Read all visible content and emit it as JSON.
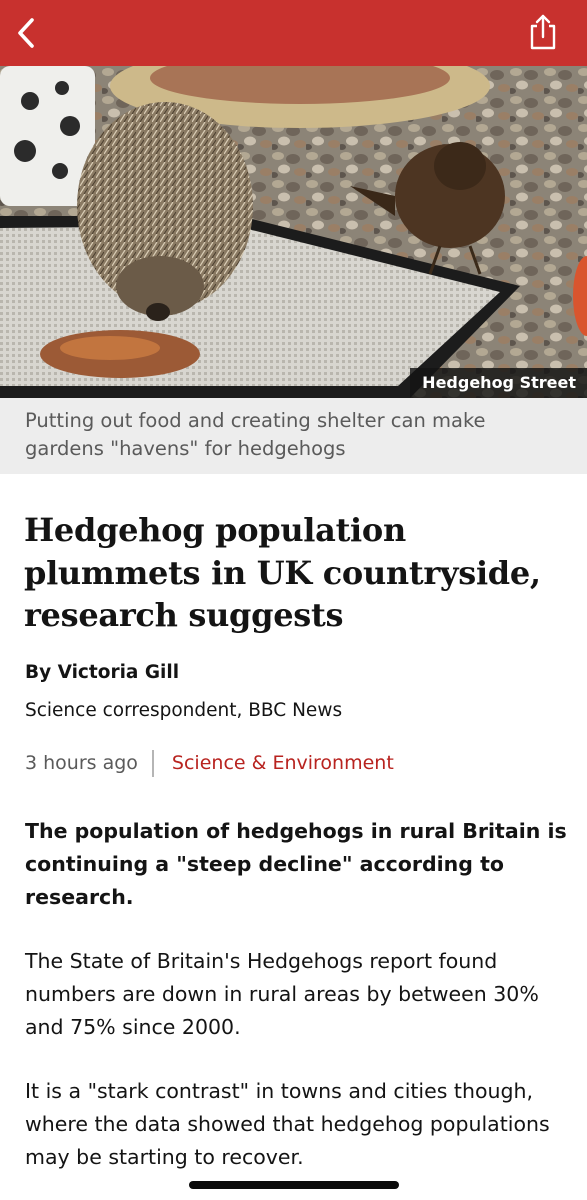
{
  "header": {
    "back_icon": "chevron-left-icon",
    "share_icon": "share-icon",
    "bar_color": "#c8312e"
  },
  "hero": {
    "credit": "Hedgehog Street",
    "caption": "Putting out food and creating shelter can make gardens \"havens\" for hedgehogs"
  },
  "article": {
    "headline": "Hedgehog population plummets in UK countryside, research suggests",
    "author": "By Victoria Gill",
    "author_role": "Science correspondent, BBC News",
    "timestamp": "3 hours ago",
    "topic": "Science & Environment",
    "topic_color": "#b8231f",
    "lead": "The population of hedgehogs in rural Britain is continuing a \"steep decline\" according to research.",
    "paragraphs": [
      "The State of Britain's Hedgehogs report found numbers are down in rural areas by between 30% and 75% since 2000.",
      "It is a \"stark contrast\" in towns and cities though, where the data showed that hedgehog populations may be starting to recover."
    ]
  }
}
